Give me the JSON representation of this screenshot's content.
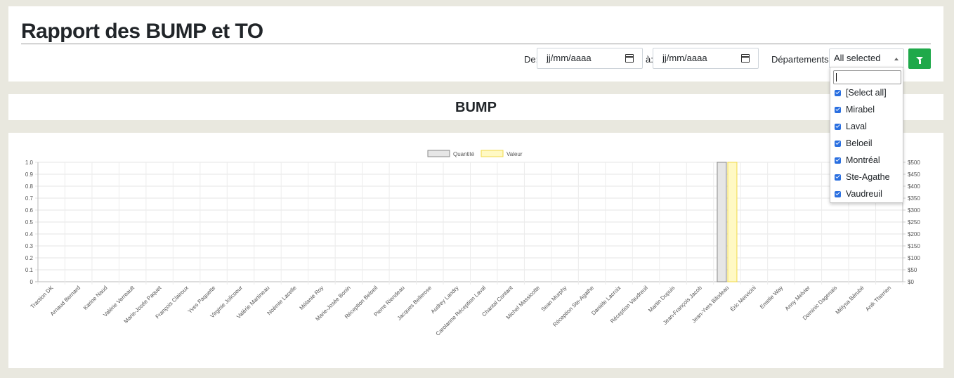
{
  "page": {
    "title": "Rapport des BUMP et TO"
  },
  "filters": {
    "from_label": "De:",
    "from_placeholder": "jj/mm/aaaa",
    "to_label": "à:",
    "to_placeholder": "jj/mm/aaaa",
    "departments_label": "Départements:",
    "departments_selected": "All selected",
    "filter_icon": "filter-icon",
    "dropdown_items": [
      "[Select all]",
      "Mirabel",
      "Laval",
      "Beloeil",
      "Montréal",
      "Ste-Agathe",
      "Vaudreuil"
    ]
  },
  "section": {
    "title": "BUMP"
  },
  "colors": {
    "filter_button": "#1fa94a",
    "quantite_fill": "#e6e6e6",
    "quantite_border": "#888888",
    "valeur_fill": "#fff9c4",
    "valeur_border": "#f0d94a",
    "checkbox": "#2a6fe0"
  },
  "chart_data": {
    "type": "bar",
    "categories": [
      "Traction DK",
      "Arnaud Bernard",
      "Karine Naud",
      "Valérie Verreault",
      "Marie-Josée Paquet",
      "François Clairoux",
      "Yves Paquette",
      "Virginie Jolicoeur",
      "Valérie Martineau",
      "Noémie Lacelle",
      "Mélanie Roy",
      "Marie-Josée Bonin",
      "Réception Beloeil",
      "Pierre Riendeau",
      "Jacques Bellerose",
      "Audrey Landry",
      "Carolanne Réception Laval",
      "Chantal Contant",
      "Michel Massicotte",
      "Sean Murphy",
      "Réception Ste-Agathe",
      "Danièle  Lacroix",
      "Réception Vaudreuil",
      "Martin Dupuis",
      "Jean-François Jacob",
      "Jean-Yves Bilodeau",
      "Éric Mervicini",
      "Emelie Way",
      "Anny Melvier",
      "Dominic Dagenais",
      "Mélysa Bérubé",
      "Anik Therrien"
    ],
    "series": [
      {
        "name": "Quantité",
        "axis": "left",
        "values": [
          0,
          0,
          0,
          0,
          0,
          0,
          0,
          0,
          0,
          0,
          0,
          0,
          0,
          0,
          0,
          0,
          0,
          0,
          0,
          0,
          0,
          0,
          0,
          0,
          0,
          1,
          0,
          0,
          0,
          0,
          0,
          0
        ]
      },
      {
        "name": "Valeur",
        "axis": "right",
        "values": [
          0,
          0,
          0,
          0,
          0,
          0,
          0,
          0,
          0,
          0,
          0,
          0,
          0,
          0,
          0,
          0,
          0,
          0,
          0,
          0,
          0,
          0,
          0,
          0,
          0,
          500,
          0,
          0,
          0,
          0,
          0,
          0
        ]
      }
    ],
    "left_axis": {
      "min": 0,
      "max": 1.0,
      "ticks": [
        "0",
        "0.1",
        "0.2",
        "0.3",
        "0.4",
        "0.5",
        "0.6",
        "0.7",
        "0.8",
        "0.9",
        "1.0"
      ]
    },
    "right_axis": {
      "min": 0,
      "max": 500,
      "ticks": [
        "$0",
        "$50",
        "$100",
        "$150",
        "$200",
        "$250",
        "$300",
        "$350",
        "$400",
        "$450",
        "$500"
      ]
    },
    "legend_position": "top-center",
    "grid": true
  }
}
